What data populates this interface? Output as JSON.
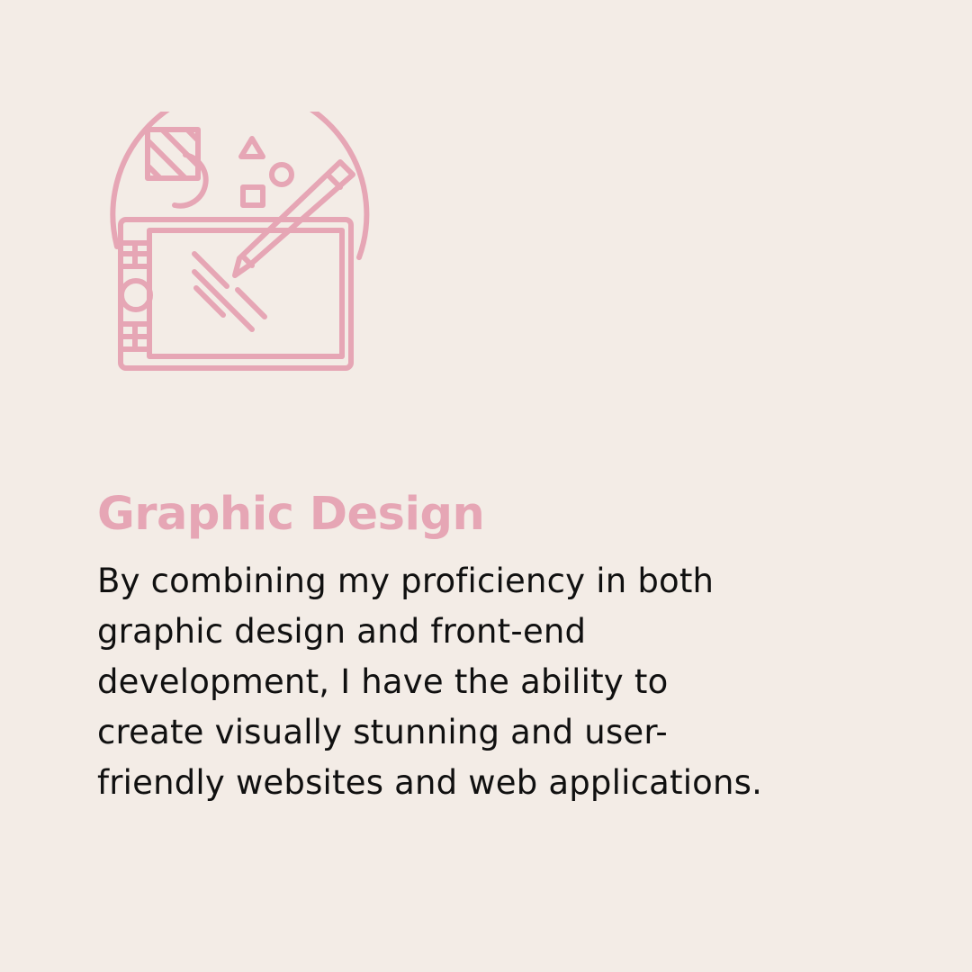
{
  "colors": {
    "background": "#F3ECE6",
    "accent": "#E6A6B5",
    "text": "#101010"
  },
  "illustration": {
    "icon": "graphic-design-tablet-icon"
  },
  "title": "Graphic Design",
  "description": "By combining my proficiency in both graphic design and front-end development, I have the ability to create visually stunning and user-friendly websites and web applications."
}
